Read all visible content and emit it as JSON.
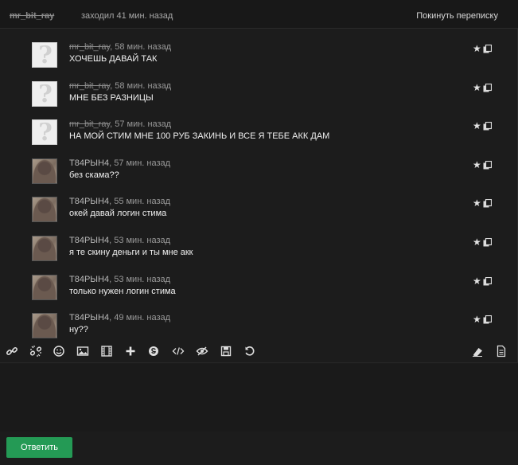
{
  "header": {
    "username": "mr_bit_ray",
    "last_seen": "заходил 41 мин. назад",
    "leave_label": "Покинуть переписку"
  },
  "messages": [
    {
      "author": "mr_bit_ray",
      "time": ", 58 мин. назад",
      "text": "ХОЧЕШЬ ДАВАЙ ТАК",
      "avatar": "default",
      "strike": true
    },
    {
      "author": "mr_bit_ray",
      "time": ", 58 мин. назад",
      "text": "МНЕ БЕЗ РАЗНИЦЫ",
      "avatar": "default",
      "strike": true
    },
    {
      "author": "mr_bit_ray",
      "time": ", 57 мин. назад",
      "text": "НА МОЙ СТИМ МНЕ 100 РУБ ЗАКИНЬ И ВСЕ Я ТЕБЕ АКК ДАМ",
      "avatar": "default",
      "strike": true
    },
    {
      "author": "T84PЫH4",
      "time": ", 57 мин. назад",
      "text": "без скама??",
      "avatar": "photo",
      "strike": false
    },
    {
      "author": "T84PЫH4",
      "time": ", 55 мин. назад",
      "text": "окей давай логин стима",
      "avatar": "photo",
      "strike": false
    },
    {
      "author": "T84PЫH4",
      "time": ", 53 мин. назад",
      "text": "я те скину деньги и ты мне акк",
      "avatar": "photo",
      "strike": false
    },
    {
      "author": "T84PЫH4",
      "time": ", 53 мин. назад",
      "text": "только нужен логин стима",
      "avatar": "photo",
      "strike": false
    },
    {
      "author": "T84PЫH4",
      "time": ", 49 мин. назад",
      "text": "ну??",
      "avatar": "photo",
      "strike": false
    }
  ],
  "toolbar": {
    "icons": [
      "link-icon",
      "unlink-icon",
      "smiley-icon",
      "image-icon",
      "video-icon",
      "plus-icon",
      "skype-icon",
      "code-icon",
      "hide-icon",
      "save-icon",
      "undo-icon",
      "eraser-icon",
      "document-icon"
    ]
  },
  "reply_label": "Ответить",
  "colors": {
    "background": "#1c1c1c",
    "reply_button": "#249a55",
    "text": "#f0f0f0",
    "muted": "#9a9a9a"
  }
}
